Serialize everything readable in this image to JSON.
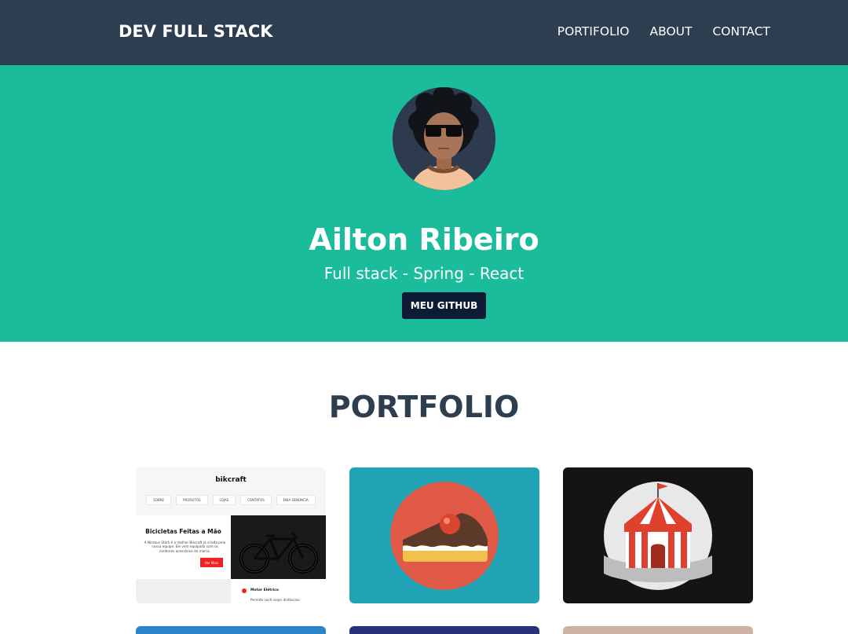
{
  "header": {
    "brand": "DEV FULL STACK",
    "nav": [
      "PORTIFOLIO",
      "ABOUT",
      "CONTACT"
    ]
  },
  "hero": {
    "name": "Ailton Ribeiro",
    "subtitle": "Full stack - Spring - React",
    "button": "MEU GITHUB"
  },
  "portfolio": {
    "title": "PORTFOLIO",
    "cards": [
      {
        "kind": "website-screenshot",
        "site_title": "bikcraft",
        "menu": [
          "SOBRE",
          "PRODUTOS",
          "LOJAS",
          "CONTATOS",
          "ENIA DENÚNCIA"
        ],
        "heading": "Bicicletas Feitas a Mão",
        "text": "A Nimbus Stark é a melhor Bikcraft já criada pela nossa equipe. Ele vem equipada com os melhores acessórios da marca.",
        "button": "Ver Mais",
        "feature_title": "Motor Elétrico",
        "feature_text": "Permite você viajar distâncias"
      },
      {
        "kind": "cake-icon"
      },
      {
        "kind": "circus-tent-icon"
      }
    ]
  },
  "colors": {
    "navbar": "#2c3e50",
    "hero": "#1abc9c",
    "button": "#0d1b35",
    "section_title": "#2c3e50",
    "card_cake_bg": "#1fa3b5",
    "card_circus_bg": "#151313"
  }
}
